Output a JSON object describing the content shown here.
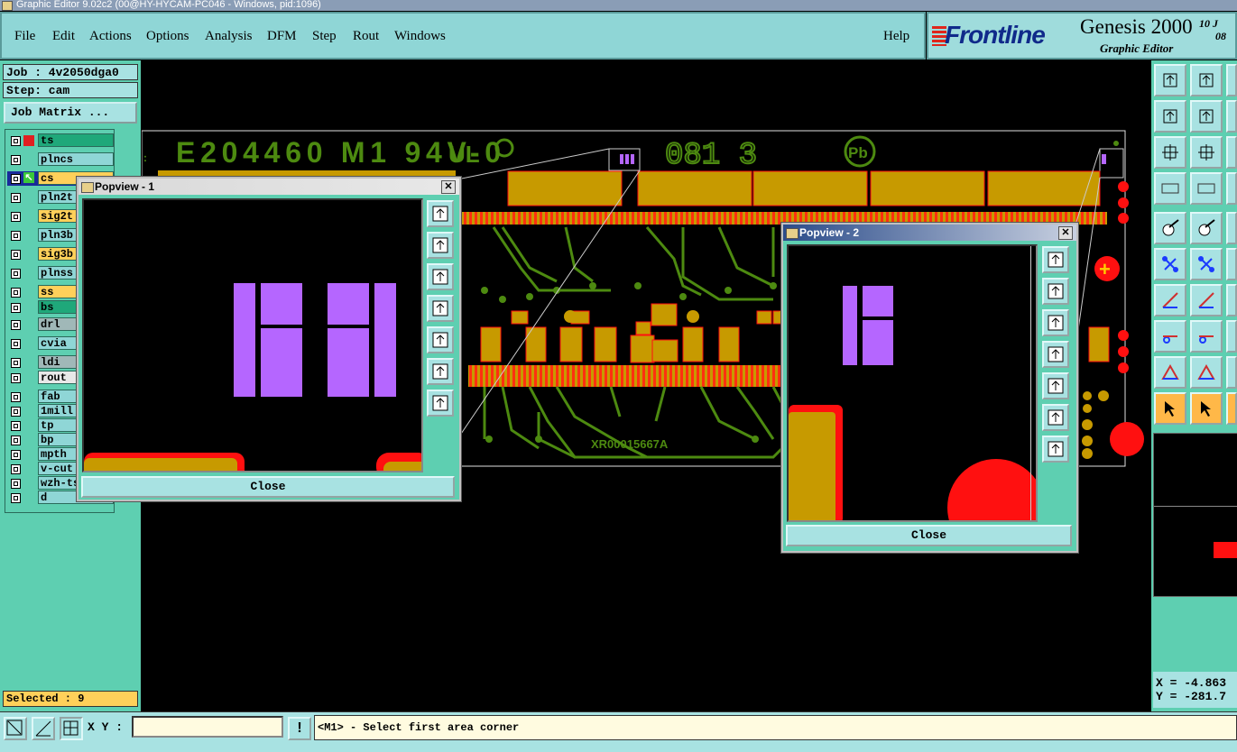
{
  "window": {
    "title": "Graphic Editor 9.02c2 (00@HY-HYCAM-PC046 - Windows, pid:1096)"
  },
  "menu": {
    "file": "File",
    "edit": "Edit",
    "actions": "Actions",
    "options": "Options",
    "analysis": "Analysis",
    "dfm": "DFM",
    "step": "Step",
    "rout": "Rout",
    "windows": "Windows",
    "help": "Help"
  },
  "branding": {
    "logo": "Frontline",
    "product": "Genesis 2000",
    "subtitle": "Graphic Editor",
    "date_line1": "10 J",
    "date_line2": "08"
  },
  "job": {
    "label": "Job : 4v2050dga0",
    "step": "Step: cam",
    "matrix_button": "Job Matrix ..."
  },
  "layers": [
    {
      "name": "ts",
      "color": "#1fa87a",
      "swatch": "#e02020",
      "mode": "none"
    },
    {
      "name": "plncs",
      "color": "#8fd6d6",
      "mode": "none"
    },
    {
      "name": "cs",
      "color": "#ffd05a",
      "mode": "work"
    },
    {
      "name": "pln2t",
      "color": "#8fd6d6",
      "mode": "none"
    },
    {
      "name": "sig2t",
      "color": "#ffd05a",
      "mode": "none"
    },
    {
      "name": "pln3b",
      "color": "#8fd6d6",
      "mode": "none"
    },
    {
      "name": "sig3b",
      "color": "#ffd05a",
      "mode": "none"
    },
    {
      "name": "plnss",
      "color": "#8fd6d6",
      "mode": "none"
    },
    {
      "name": "ss",
      "color": "#ffd05a",
      "mode": "none"
    },
    {
      "name": "bs",
      "color": "#1fa87a",
      "mode": "none"
    },
    {
      "name": "drl",
      "color": "#a0b8b8",
      "mode": "none"
    },
    {
      "name": "cvia",
      "color": "#8fd6d6",
      "mode": "none"
    },
    {
      "name": "ldi",
      "color": "#a0b8b8",
      "mode": "none"
    },
    {
      "name": "rout",
      "color": "#e8e8e8",
      "mode": "none"
    },
    {
      "name": "fab",
      "color": "#8fd6d6",
      "mode": "none"
    },
    {
      "name": "1mill",
      "color": "#8fd6d6",
      "mode": "none"
    },
    {
      "name": "tp",
      "color": "#8fd6d6",
      "mode": "none"
    },
    {
      "name": "bp",
      "color": "#8fd6d6",
      "mode": "none"
    },
    {
      "name": "mpth",
      "color": "#8fd6d6",
      "mode": "none"
    },
    {
      "name": "v-cut",
      "color": "#8fd6d6",
      "mode": "none"
    },
    {
      "name": "wzh-ts",
      "color": "#8fd6d6",
      "mode": "none"
    },
    {
      "name": "d",
      "color": "#8fd6d6",
      "mode": "none"
    }
  ],
  "status": {
    "selected": "Selected : 9"
  },
  "coords": {
    "x": "X = -4.863",
    "y": "Y = -281.7"
  },
  "bottom": {
    "xy_label": "X Y :",
    "xy_value": "",
    "warning": "!",
    "message": "<M1> - Select first area corner"
  },
  "board": {
    "silkscreen": "E204460  M1  94V-0",
    "ul_mark": "UL",
    "date_code": "081 3",
    "pb_mark": "Pb",
    "part_no": "XR00015667A"
  },
  "popup1": {
    "title": "Popview - 1",
    "close_label": "Close"
  },
  "popup2": {
    "title": "Popview - 2",
    "close_label": "Close"
  },
  "colors": {
    "copper": "#c79a00",
    "trace": "#4d8a10",
    "pad_red": "#ff1010",
    "feature": "#b566ff",
    "panel": "#5ecfb1"
  }
}
